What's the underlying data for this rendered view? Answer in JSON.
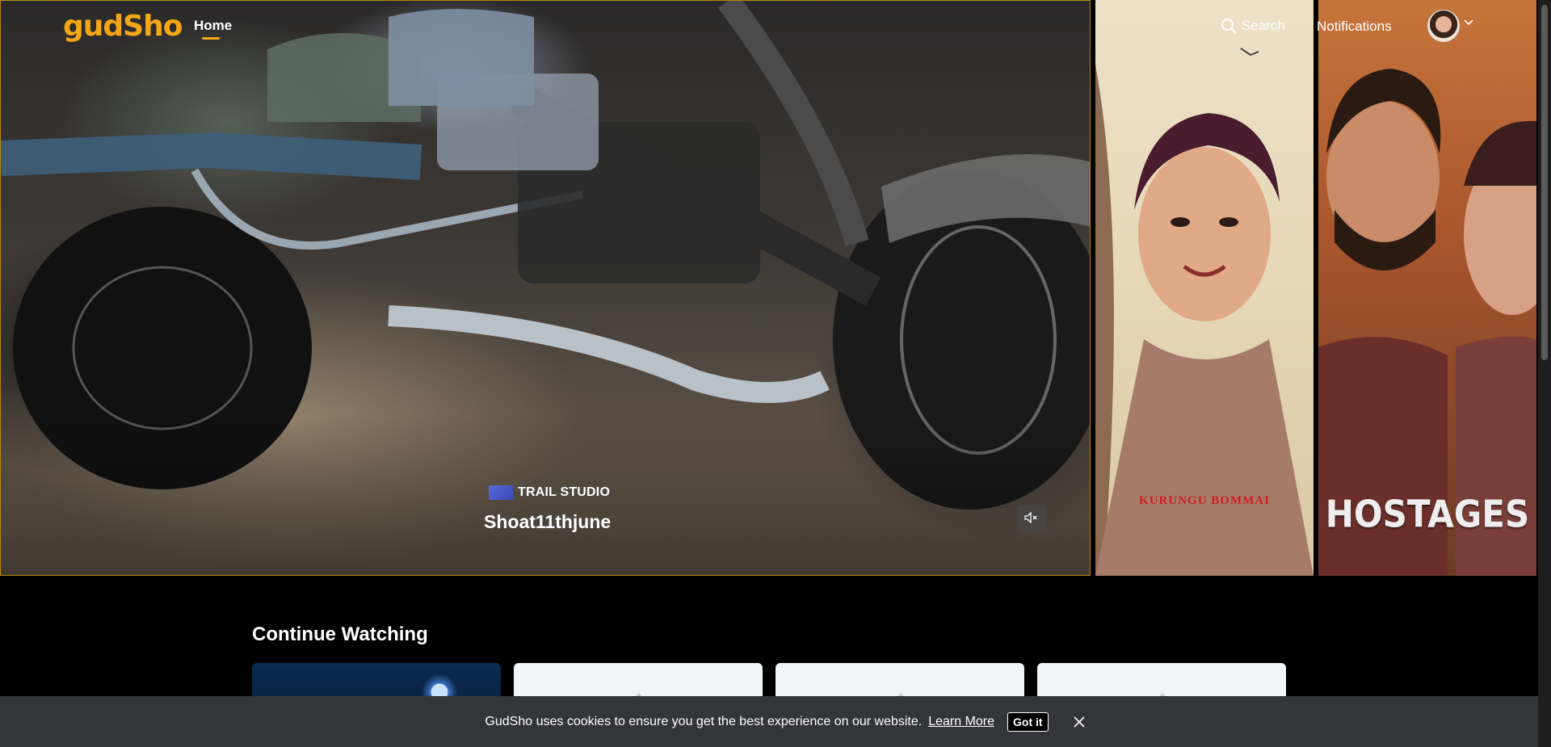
{
  "brand": {
    "logo_text": "gudSho",
    "accent": "#f3a716"
  },
  "nav": {
    "home_label": "Home",
    "search_label": "Search",
    "notifications_label": "Notifications"
  },
  "hero": {
    "studio": "TRAIL STUDIO",
    "title": "Shoat11thjune",
    "mute_icon": "mute-icon"
  },
  "posters": [
    {
      "title": "KURUNGU BOMMAI",
      "title_color": "#d21d1d"
    },
    {
      "title": "HOSTAGES",
      "title_color": "#eeeeee"
    }
  ],
  "continue_watching": {
    "title": "Continue Watching",
    "cards": 4
  },
  "cookie": {
    "message": "GudSho uses cookies to ensure you get the best experience on our website.",
    "link": "Learn More",
    "button": "Got it"
  }
}
